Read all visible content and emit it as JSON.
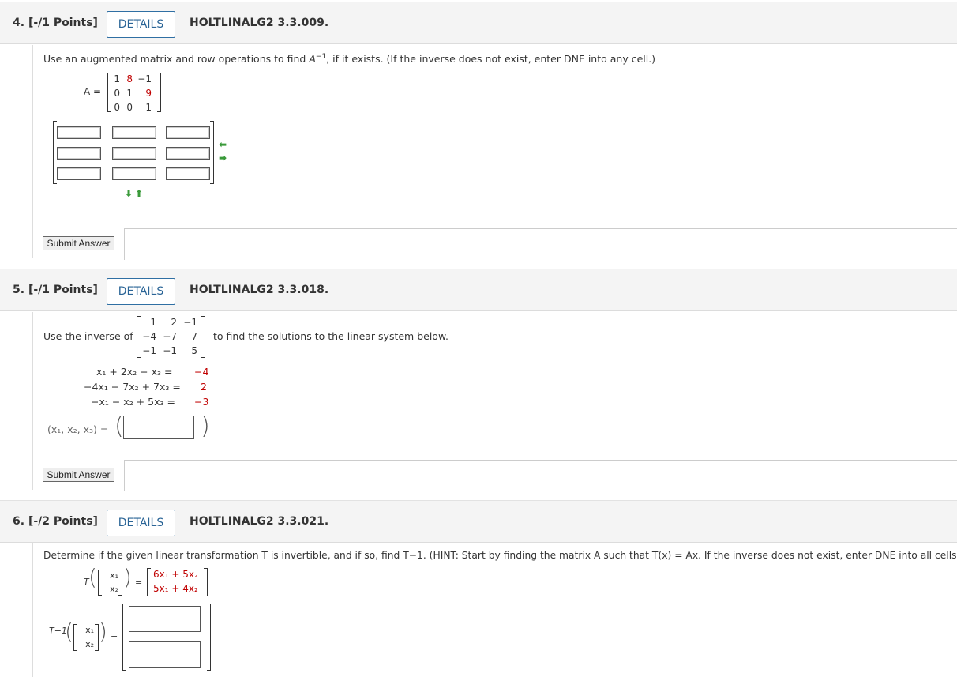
{
  "questions": [
    {
      "number": "4.",
      "points": "[-/1 Points]",
      "details_label": "DETAILS",
      "code": "HOLTLINALG2 3.3.009.",
      "prompt_pre": "Use an augmented matrix and row operations to find ",
      "prompt_sym": "A",
      "prompt_sup": "−1",
      "prompt_post": ", if it exists. (If the inverse does not exist, enter DNE into any cell.)",
      "matrix_label": "A =",
      "matrix": [
        [
          "1",
          "8",
          "−1"
        ],
        [
          "0",
          "1",
          "9"
        ],
        [
          "0",
          "0",
          "1"
        ]
      ],
      "submit_label": "Submit Answer"
    },
    {
      "number": "5.",
      "points": "[-/1 Points]",
      "details_label": "DETAILS",
      "code": "HOLTLINALG2 3.3.018.",
      "prompt_pre": "Use the inverse of",
      "prompt_post": "to find the solutions to the linear system below.",
      "matrix": [
        [
          "1",
          "2",
          "−1"
        ],
        [
          "−4",
          "−7",
          "7"
        ],
        [
          "−1",
          "−1",
          "5"
        ]
      ],
      "system": [
        {
          "lhs": "x₁ + 2x₂ − x₃ =",
          "rhs": "−4"
        },
        {
          "lhs": "−4x₁ − 7x₂ + 7x₃ =",
          "rhs": "2"
        },
        {
          "lhs": "−x₁ − x₂ + 5x₃ =",
          "rhs": "−3"
        }
      ],
      "tuple_label": "(x₁, x₂, x₃) =",
      "submit_label": "Submit Answer"
    },
    {
      "number": "6.",
      "points": "[-/2 Points]",
      "details_label": "DETAILS",
      "code": "HOLTLINALG2 3.3.021.",
      "prompt": "Determine if the given linear transformation T is invertible, and if so, find T−1. (HINT: Start by finding the matrix A such that T(x) = Ax. If the inverse does not exist, enter DNE into all cells.)",
      "t_label": "T",
      "tinv_label": "T−1",
      "vec": [
        "x₁",
        "x₂"
      ],
      "result": [
        "6x₁ + 5x₂",
        "5x₁ + 4x₂"
      ],
      "equals": "="
    }
  ],
  "colors": {
    "accent": "#2a6496",
    "red": "#c00000",
    "arrow_green": "#3a9a3a"
  }
}
